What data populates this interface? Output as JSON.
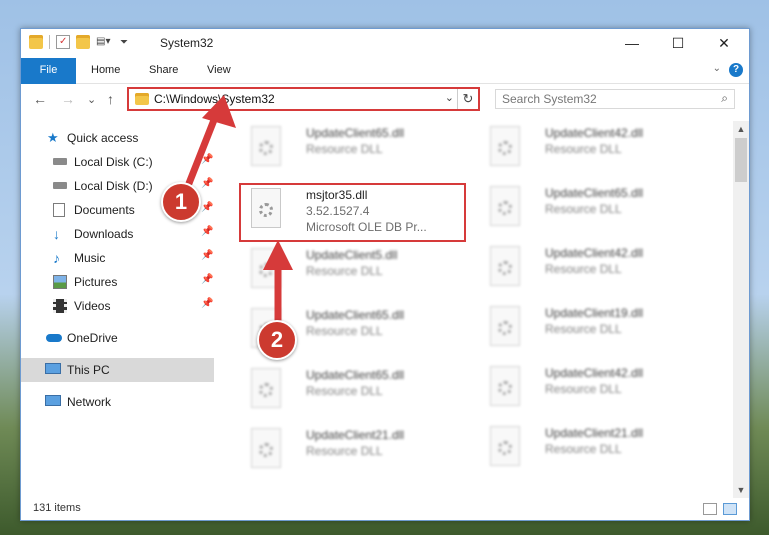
{
  "window": {
    "title": "System32",
    "controls": {
      "minimize": "—",
      "maximize": "☐",
      "close": "✕"
    }
  },
  "ribbon": {
    "tabs": [
      "File",
      "Home",
      "Share",
      "View"
    ],
    "help": "?",
    "collapse": "⌄"
  },
  "nav": {
    "back": "←",
    "forward": "→",
    "recent": "⌄",
    "up": "↑",
    "address": "C:\\Windows\\System32",
    "address_dropdown": "⌄",
    "refresh": "↻",
    "search_placeholder": "Search System32",
    "search_icon": "⌕"
  },
  "sidebar": {
    "items": [
      {
        "label": "Quick access",
        "icon": "star-icon",
        "pinned": false
      },
      {
        "label": "Local Disk (C:)",
        "icon": "drive-icon",
        "pinned": true
      },
      {
        "label": "Local Disk (D:)",
        "icon": "drive-icon",
        "pinned": true
      },
      {
        "label": "Documents",
        "icon": "documents-icon",
        "pinned": true
      },
      {
        "label": "Downloads",
        "icon": "downloads-icon",
        "pinned": true
      },
      {
        "label": "Music",
        "icon": "music-icon",
        "pinned": true
      },
      {
        "label": "Pictures",
        "icon": "pictures-icon",
        "pinned": true
      },
      {
        "label": "Videos",
        "icon": "videos-icon",
        "pinned": true
      },
      {
        "label": "OneDrive",
        "icon": "cloud-icon",
        "pinned": false
      },
      {
        "label": "This PC",
        "icon": "computer-icon",
        "pinned": false,
        "selected": true
      },
      {
        "label": "Network",
        "icon": "network-icon",
        "pinned": false
      }
    ],
    "pin_glyph": "📌"
  },
  "files": {
    "highlighted": {
      "name": "msjtor35.dll",
      "version": "3.52.1527.4",
      "description": "Microsoft OLE DB Pr..."
    },
    "left": [
      {
        "name": "UpdateClient65.dll",
        "type": "Resource DLL"
      },
      {
        "name": "UpdateClient5.dll",
        "type": "Resource DLL"
      },
      {
        "name": "UpdateClient65.dll",
        "type": "Resource DLL"
      },
      {
        "name": "UpdateClient65.dll",
        "type": "Resource DLL"
      },
      {
        "name": "UpdateClient21.dll",
        "type": "Resource DLL"
      }
    ],
    "right": [
      {
        "name": "UpdateClient42.dll",
        "type": "Resource DLL"
      },
      {
        "name": "UpdateClient65.dll",
        "type": "Resource DLL"
      },
      {
        "name": "UpdateClient42.dll",
        "type": "Resource DLL"
      },
      {
        "name": "UpdateClient19.dll",
        "type": "Resource DLL"
      },
      {
        "name": "UpdateClient42.dll",
        "type": "Resource DLL"
      },
      {
        "name": "UpdateClient21.dll",
        "type": "Resource DLL"
      }
    ]
  },
  "status": {
    "item_count": "131 items"
  },
  "callouts": {
    "one": "1",
    "two": "2"
  },
  "colors": {
    "accent": "#1979ca",
    "highlight": "#d63a3a",
    "badge": "#cc3a2f"
  }
}
